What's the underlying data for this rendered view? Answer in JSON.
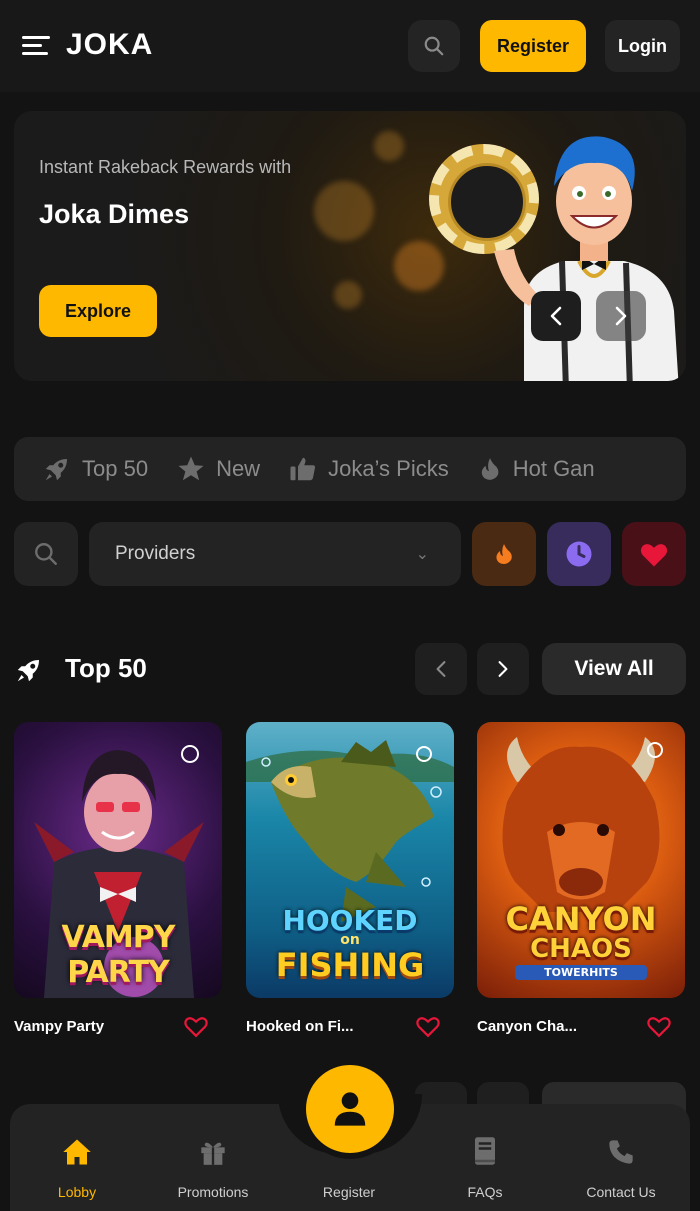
{
  "header": {
    "logo": "JOKA",
    "register_label": "Register",
    "login_label": "Login"
  },
  "hero": {
    "subtitle": "Instant Rakeback Rewards with",
    "title": "Joka Dimes",
    "cta_label": "Explore"
  },
  "categories": [
    {
      "label": "Top 50",
      "icon": "rocket-icon"
    },
    {
      "label": "New",
      "icon": "star-icon"
    },
    {
      "label": "Joka’s Picks",
      "icon": "thumbs-up-icon"
    },
    {
      "label": "Hot Gan",
      "icon": "flame-icon"
    }
  ],
  "filters": {
    "providers_label": "Providers",
    "hot_color": "#f57c1f",
    "recent_color": "#8b6cf0",
    "favorites_color": "#e8173a"
  },
  "section": {
    "title": "Top 50",
    "view_all_label": "View All"
  },
  "games": [
    {
      "name": "Vampy Party",
      "art_title": "VAMPY PARTY"
    },
    {
      "name": "Hooked on Fi...",
      "art_title_1": "HOOKED",
      "art_title_2": "on",
      "art_title_3": "FISHING"
    },
    {
      "name": "Canyon Cha...",
      "art_title_1": "CANYON",
      "art_title_2": "CHAOS",
      "art_title_3": "TOWERHITS"
    }
  ],
  "bottom_nav": [
    {
      "label": "Lobby",
      "icon": "home-icon"
    },
    {
      "label": "Promotions",
      "icon": "gift-icon"
    },
    {
      "label": "Register",
      "icon": "user-icon"
    },
    {
      "label": "FAQs",
      "icon": "book-icon"
    },
    {
      "label": "Contact Us",
      "icon": "phone-icon"
    }
  ],
  "colors": {
    "accent": "#ffb800",
    "background": "#131313",
    "surface": "#232323"
  }
}
